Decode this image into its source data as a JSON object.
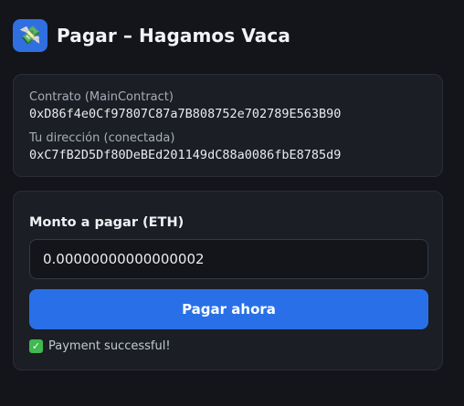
{
  "header": {
    "icon": "money-with-wings-icon",
    "icon_glyph": "💸",
    "title": "Pagar – Hagamos Vaca"
  },
  "contract": {
    "label": "Contrato (MainContract)",
    "address": "0xD86f4e0Cf97807C87a7B808752e702789E563B90"
  },
  "wallet": {
    "label": "Tu dirección (conectada)",
    "address": "0xC7fB2D5Df80DeBEd201149dC88a0086fbE8785d9"
  },
  "payment": {
    "amount_label": "Monto a pagar (ETH)",
    "amount_value": "0.00000000000000002",
    "button_label": "Pagar ahora",
    "status_icon": "check-mark-icon",
    "status_glyph": "✓",
    "status_text": "Payment successful!"
  },
  "colors": {
    "background": "#13151b",
    "card": "#1b1e25",
    "accent": "#2970e8",
    "success": "#3fb950"
  }
}
